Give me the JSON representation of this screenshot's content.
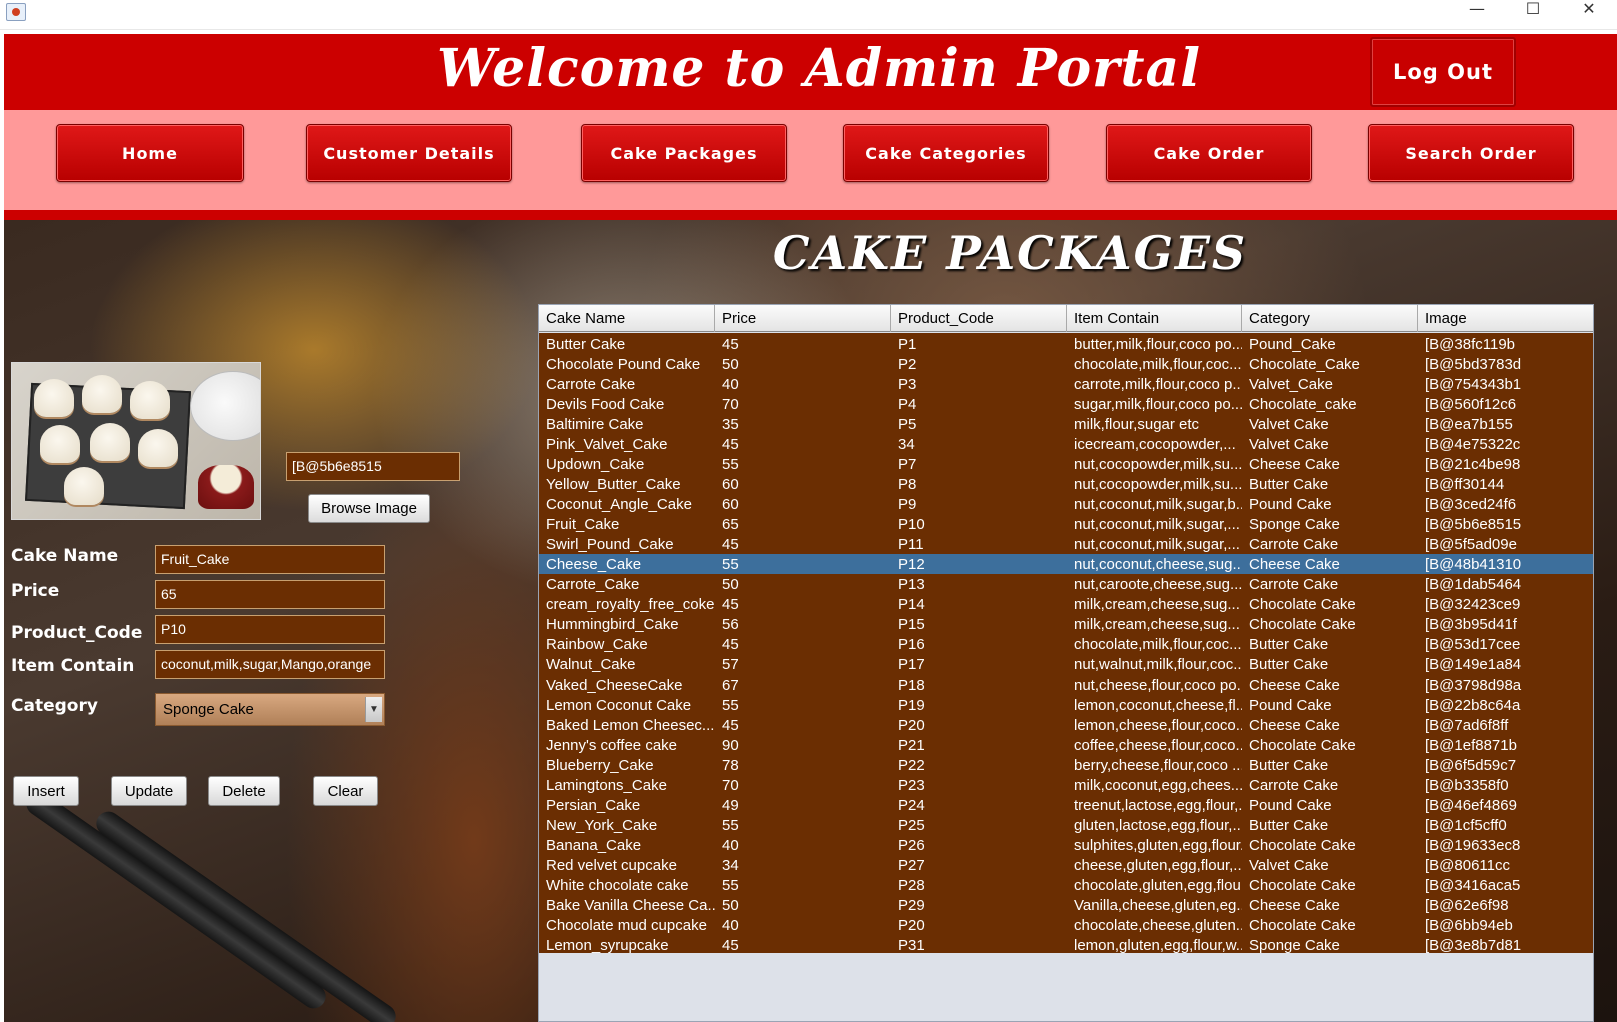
{
  "window": {
    "minimize_glyph": "—",
    "maximize_glyph": "☐",
    "close_glyph": "✕"
  },
  "header": {
    "title": "Welcome to  Admin Portal",
    "logout_label": "Log Out"
  },
  "nav": {
    "items": [
      {
        "label": "Home"
      },
      {
        "label": "Customer Details"
      },
      {
        "label": "Cake Packages"
      },
      {
        "label": "Cake Categories"
      },
      {
        "label": "Cake Order"
      },
      {
        "label": "Search Order"
      }
    ]
  },
  "page_title": "CAKE PACKAGES",
  "form": {
    "image_path": "[B@5b6e8515",
    "browse_label": "Browse Image",
    "labels": {
      "cake_name": "Cake Name",
      "price": "Price",
      "product_code": "Product_Code",
      "item_contain": "Item Contain",
      "category": "Category"
    },
    "values": {
      "cake_name": "Fruit_Cake",
      "price": "65",
      "product_code": "P10",
      "item_contain": "coconut,milk,sugar,Mango,orange",
      "category": "Sponge Cake"
    },
    "buttons": {
      "insert": "Insert",
      "update": "Update",
      "delete": "Delete",
      "clear": "Clear"
    }
  },
  "table": {
    "columns": [
      "Cake Name",
      "Price",
      "Product_Code",
      "Item Contain",
      "Category",
      "Image"
    ],
    "selected_index": 11,
    "rows": [
      [
        "Butter Cake",
        "45",
        "P1",
        "butter,milk,flour,coco po...",
        "Pound_Cake",
        "[B@38fc119b"
      ],
      [
        "Chocolate Pound Cake",
        "50",
        "P2",
        "chocolate,milk,flour,coc...",
        "Chocolate_Cake",
        "[B@5bd3783d"
      ],
      [
        "Carrote Cake",
        "40",
        "P3",
        "carrote,milk,flour,coco p...",
        "Valvet_Cake",
        "[B@754343b1"
      ],
      [
        "Devils Food Cake",
        "70",
        "P4",
        "sugar,milk,flour,coco po...",
        "Chocolate_cake",
        "[B@560f12c6"
      ],
      [
        "Baltimire Cake",
        "35",
        "P5",
        "milk,flour,sugar etc",
        "Valvet Cake",
        "[B@ea7b155"
      ],
      [
        "Pink_Valvet_Cake",
        "45",
        "34",
        "icecream,cocopowder,...",
        "Valvet Cake",
        "[B@4e75322c"
      ],
      [
        "Updown_Cake",
        "55",
        "P7",
        "nut,cocopowder,milk,su...",
        "Cheese Cake",
        "[B@21c4be98"
      ],
      [
        "Yellow_Butter_Cake",
        "60",
        "P8",
        "nut,cocopowder,milk,su...",
        "Butter Cake",
        "[B@ff30144"
      ],
      [
        "Coconut_Angle_Cake",
        "60",
        "P9",
        "nut,coconut,milk,sugar,b...",
        "Pound Cake",
        "[B@3ced24f6"
      ],
      [
        "Fruit_Cake",
        "65",
        "P10",
        "nut,coconut,milk,sugar,...",
        "Sponge Cake",
        "[B@5b6e8515"
      ],
      [
        "Swirl_Pound_Cake",
        "45",
        "P11",
        "nut,coconut,milk,sugar,...",
        "Carrote Cake",
        "[B@5f5ad09e"
      ],
      [
        "Cheese_Cake",
        "55",
        "P12",
        "nut,coconut,cheese,sug...",
        "Cheese Cake",
        "[B@48b41310"
      ],
      [
        "Carrote_Cake",
        "50",
        "P13",
        "nut,caroote,cheese,sug...",
        "Carrote Cake",
        "[B@1dab5464"
      ],
      [
        "cream_royalty_free_coke",
        "45",
        "P14",
        "milk,cream,cheese,sug...",
        "Chocolate Cake",
        "[B@32423ce9"
      ],
      [
        "Hummingbird_Cake",
        "56",
        "P15",
        "milk,cream,cheese,sug...",
        "Chocolate Cake",
        "[B@3b95d41f"
      ],
      [
        "Rainbow_Cake",
        "45",
        "P16",
        "chocolate,milk,flour,coc...",
        "Butter Cake",
        "[B@53d17cee"
      ],
      [
        "Walnut_Cake",
        "57",
        "P17",
        "nut,walnut,milk,flour,coc...",
        "Butter Cake",
        "[B@149e1a84"
      ],
      [
        "Vaked_CheeseCake",
        "67",
        "P18",
        "nut,cheese,flour,coco po...",
        "Cheese Cake",
        "[B@3798d98a"
      ],
      [
        "Lemon Coconut Cake",
        "55",
        "P19",
        "lemon,coconut,cheese,fl...",
        "Pound Cake",
        "[B@22b8c64a"
      ],
      [
        "Baked Lemon Cheesec...",
        "45",
        "P20",
        "lemon,cheese,flour,coco...",
        "Cheese Cake",
        "[B@7ad6f8ff"
      ],
      [
        "Jenny's coffee cake",
        "90",
        "P21",
        "coffee,cheese,flour,coco...",
        "Chocolate Cake",
        "[B@1ef8871b"
      ],
      [
        "Blueberry_Cake",
        "78",
        "P22",
        "berry,cheese,flour,coco ...",
        "Butter Cake",
        "[B@6f5d59c7"
      ],
      [
        "Lamingtons_Cake",
        "70",
        "P23",
        "milk,coconut,egg,chees...",
        "Carrote Cake",
        "[B@b3358f0"
      ],
      [
        "Persian_Cake",
        "49",
        "P24",
        "treenut,lactose,egg,flour,...",
        "Pound Cake",
        "[B@46ef4869"
      ],
      [
        "New_York_Cake",
        "55",
        "P25",
        "gluten,lactose,egg,flour,...",
        "Butter Cake",
        "[B@1cf5cff0"
      ],
      [
        "Banana_Cake",
        "40",
        "P26",
        "sulphites,gluten,egg,flour...",
        "Chocolate Cake",
        "[B@19633ec8"
      ],
      [
        "Red velvet cupcake",
        "34",
        "P27",
        "cheese,gluten,egg,flour,...",
        "Valvet Cake",
        "[B@80611cc"
      ],
      [
        "White chocolate cake",
        "55",
        "P28",
        "chocolate,gluten,egg,flou...",
        "Chocolate Cake",
        "[B@3416aca5"
      ],
      [
        "Bake Vanilla Cheese Ca...",
        "50",
        "P29",
        "Vanilla,cheese,gluten,eg...",
        "Cheese Cake",
        "[B@62e6f98"
      ],
      [
        "Chocolate mud cupcake",
        "40",
        "P20",
        "chocolate,cheese,gluten...",
        "Chocolate Cake",
        "[B@6bb94eb"
      ],
      [
        "Lemon_syrupcake",
        "45",
        "P31",
        "lemon,gluten,egg,flour,w...",
        "Sponge Cake",
        "[B@3e8b7d81"
      ]
    ]
  },
  "colors": {
    "header_red": "#cc0000",
    "nav_pink": "#ff9999",
    "table_brown": "#6b2e02",
    "selection_blue": "#3d6f9c"
  }
}
